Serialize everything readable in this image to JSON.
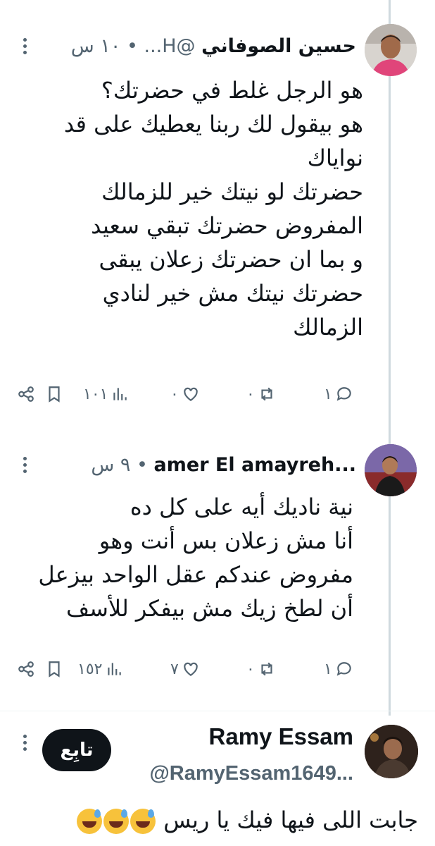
{
  "colors": {
    "text": "#0f1419",
    "muted": "#536471",
    "thread_line": "#cfd9de",
    "follow_bg": "#0f1419"
  },
  "tweets": [
    {
      "name": "حسين الصوفاني",
      "handle": "@H...",
      "time": "١٠ س",
      "separator": "•",
      "body": "هو الرجل غلط في حضرتك؟\nهو بيقول لك ربنا يعطيك على قد نواياك\nحضرتك لو نيتك خير للزمالك المفروض حضرتك تبقي سعيد\nو بما ان حضرتك زعلان يبقى حضرتك نيتك مش خير لنادي الزمالك",
      "actions": {
        "replies": "١",
        "retweets": "٠",
        "likes": "٠",
        "views": "١٠١"
      }
    },
    {
      "name": "amer El amayreh...",
      "time": "٩ س",
      "separator": "•",
      "body": "نية ناديك أيه على كل ده\nأنا مش زعلان بس أنت وهو\nمفروض عندكم عقل الواحد بيزعل\nأن لطخ زيك مش بيفكر للأسف",
      "actions": {
        "replies": "١",
        "retweets": "٠",
        "likes": "٧",
        "views": "١٥٢"
      }
    },
    {
      "name": "Ramy Essam",
      "handle": "@RamyEssam1649...",
      "follow_label": "تابِع",
      "body": "جابت اللى فيها فيك يا ريس",
      "emojis": [
        "grinning-sweat",
        "grinning-sweat",
        "grinning-sweat"
      ]
    }
  ]
}
